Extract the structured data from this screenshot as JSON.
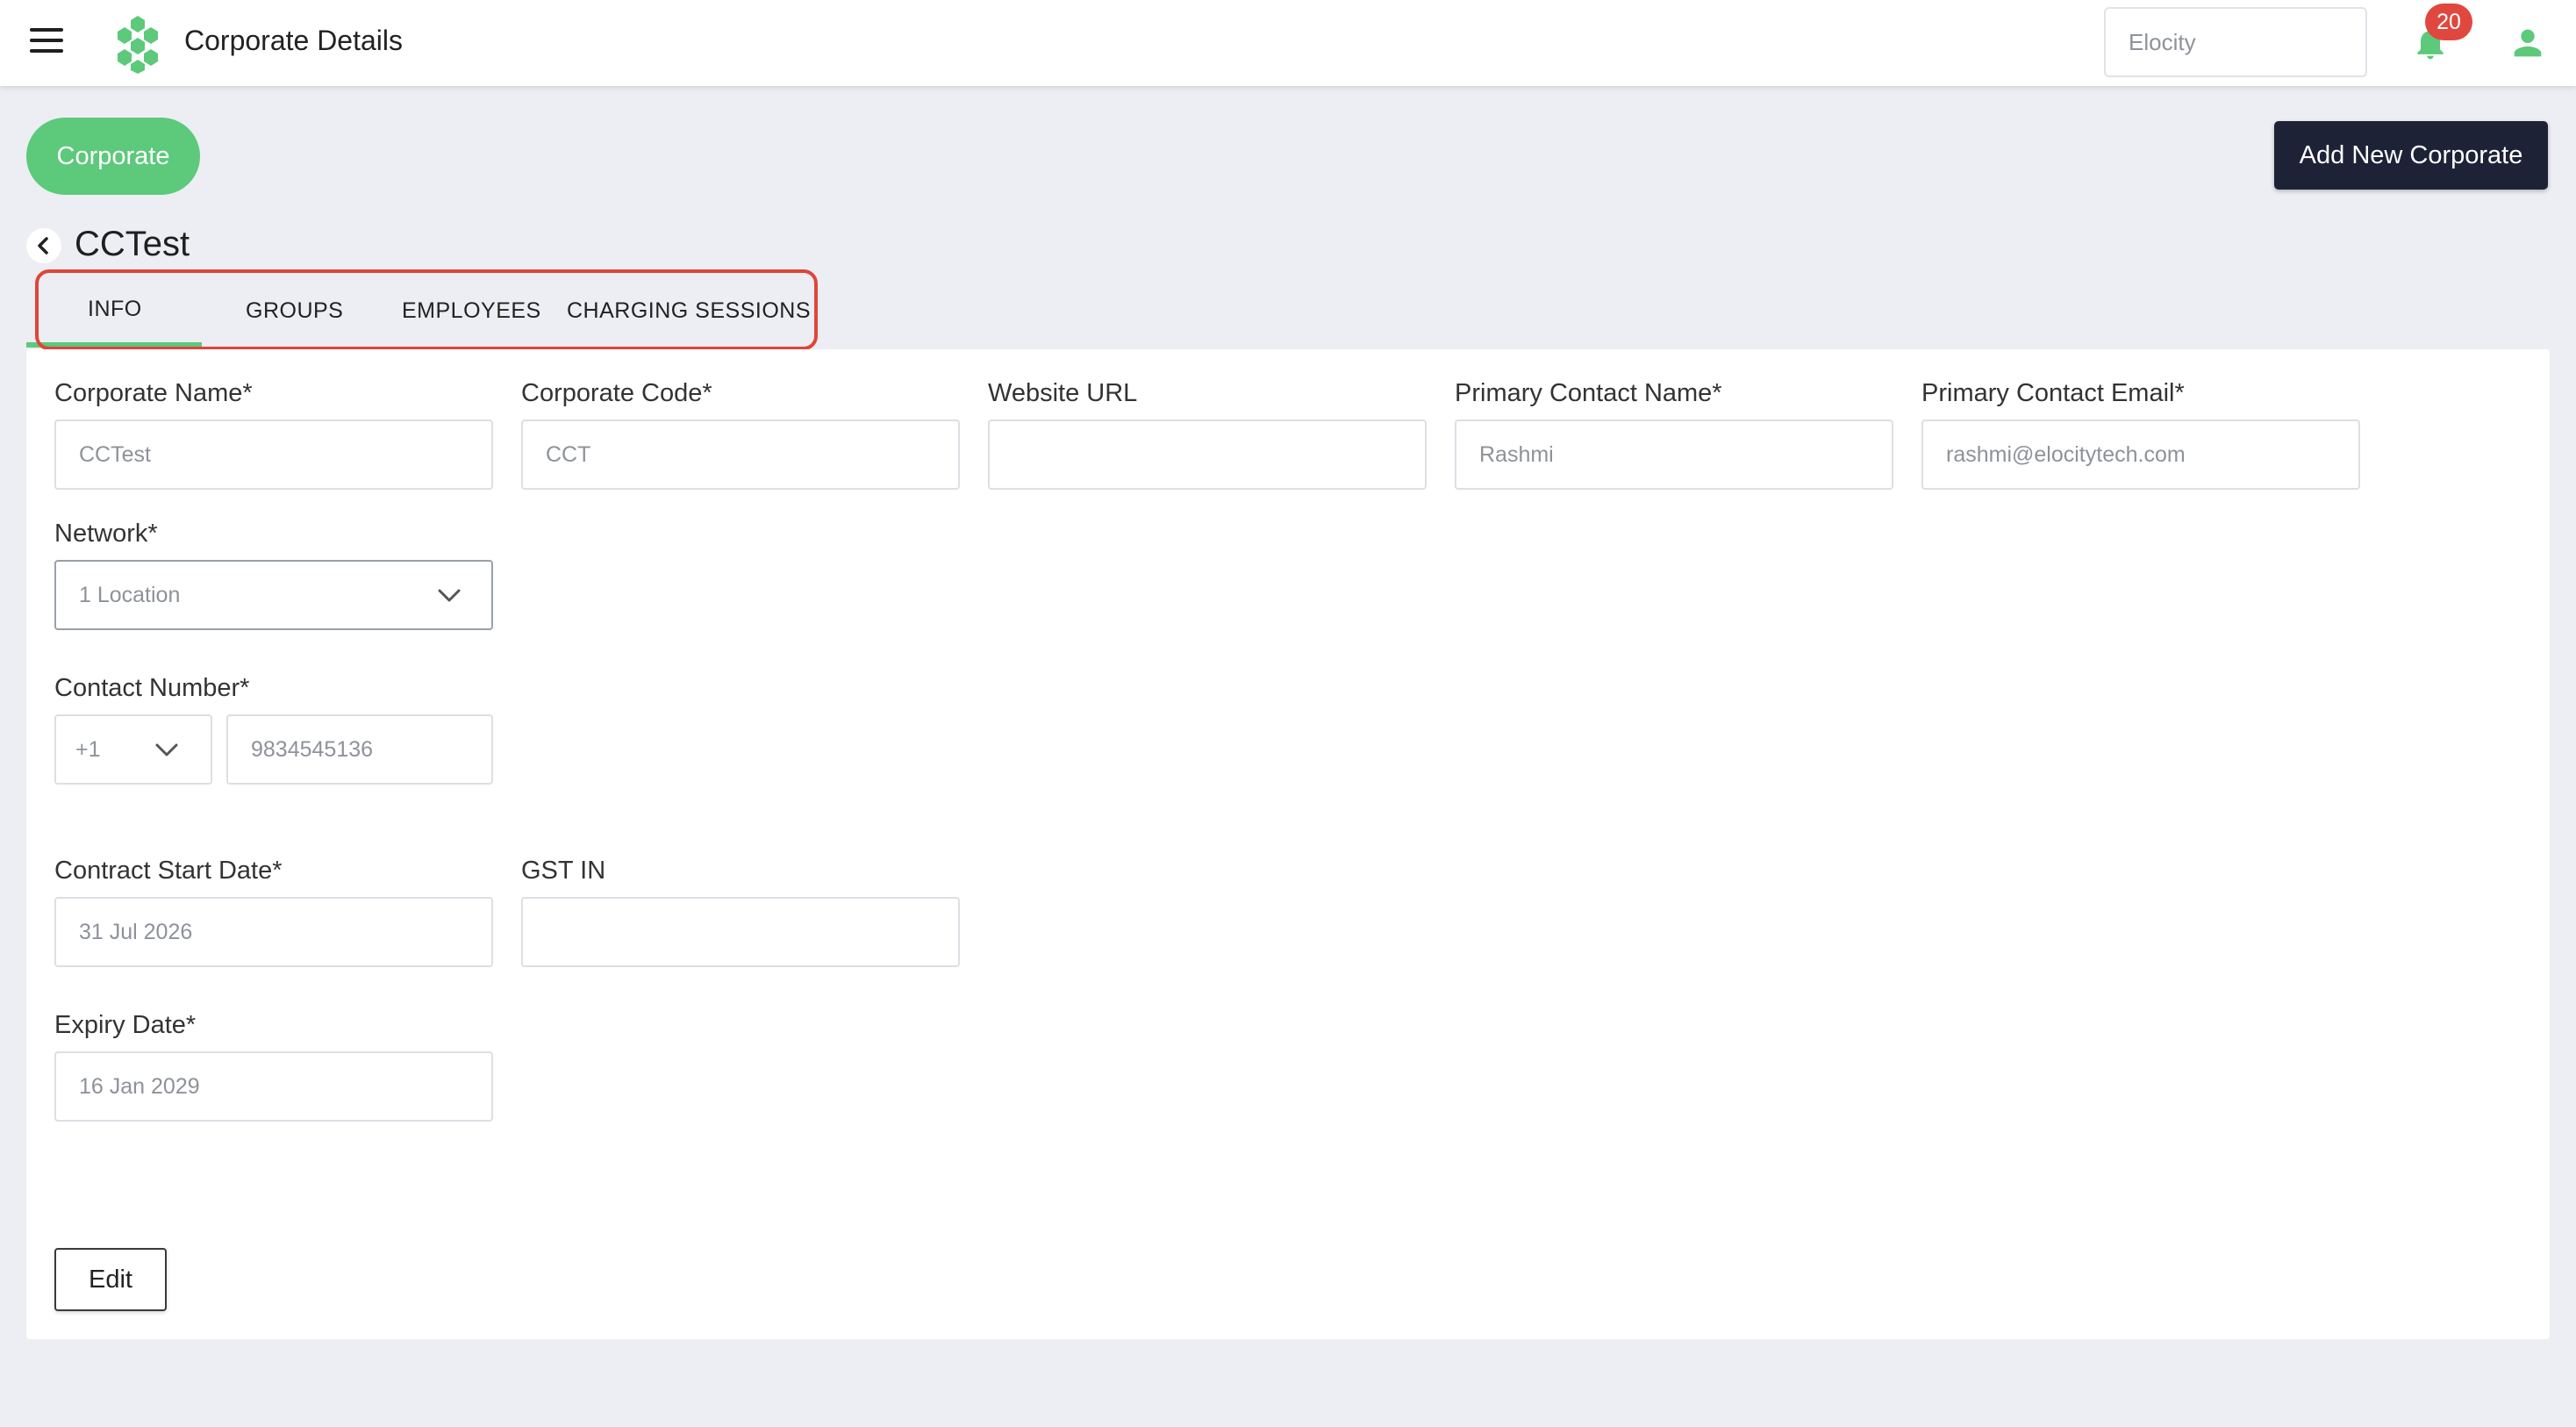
{
  "header": {
    "title": "Corporate Details",
    "org_select_value": "Elocity",
    "notification_count": "20"
  },
  "actions": {
    "corporate_pill": "Corporate",
    "add_new": "Add New Corporate"
  },
  "breadcrumb": {
    "title": "CCTest"
  },
  "tabs": [
    {
      "label": "INFO",
      "active": true
    },
    {
      "label": "GROUPS"
    },
    {
      "label": "EMPLOYEES"
    },
    {
      "label": "CHARGING SESSIONS"
    }
  ],
  "form": {
    "corporate_name": {
      "label": "Corporate Name*",
      "value": "CCTest"
    },
    "corporate_code": {
      "label": "Corporate Code*",
      "value": "CCT"
    },
    "website_url": {
      "label": "Website URL",
      "value": ""
    },
    "primary_contact_name": {
      "label": "Primary Contact Name*",
      "value": "Rashmi"
    },
    "primary_contact_email": {
      "label": "Primary Contact Email*",
      "value": "rashmi@elocitytech.com"
    },
    "network": {
      "label": "Network*",
      "value": "1 Location"
    },
    "contact_number": {
      "label": "Contact Number*",
      "country_code": "+1",
      "value": "9834545136"
    },
    "contract_start_date": {
      "label": "Contract Start Date*",
      "value": "31 Jul 2026"
    },
    "gst_in": {
      "label": "GST IN",
      "value": ""
    },
    "expiry_date": {
      "label": "Expiry Date*",
      "value": "16 Jan 2029"
    },
    "edit_label": "Edit"
  },
  "colors": {
    "accent_green": "#5cc97b",
    "dark_button": "#1d2237",
    "highlight_red": "#e0453a",
    "badge_red": "#e0483f"
  },
  "icons": [
    "menu-icon",
    "logo-icon",
    "bell-icon",
    "user-icon",
    "back-chevron-icon",
    "chevron-down-icon"
  ]
}
